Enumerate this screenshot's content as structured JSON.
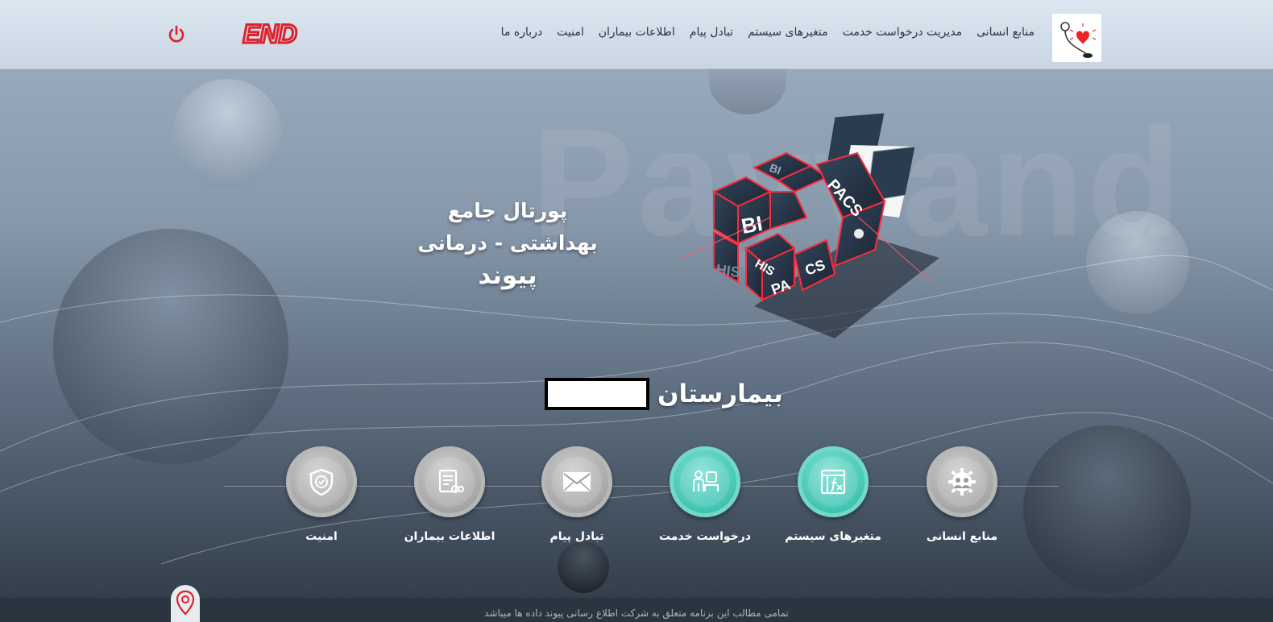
{
  "nav": {
    "items": [
      "منابع انسانی",
      "مدیریت درخواست خدمت",
      "متغیرهای سیستم",
      "تبادل پیام",
      "اطلاعات بیماران",
      "امنیت",
      "درباره ما"
    ]
  },
  "brand": {
    "text": "END"
  },
  "watermark": "Payvand",
  "hero": {
    "line1": "پورتال جامع",
    "line2": "بهداشتی - درمانی",
    "line3": "پیوند"
  },
  "cube_labels": [
    "BI",
    "PACS",
    "BI",
    "HIS",
    "HIS",
    "PA",
    "CS"
  ],
  "hospital": {
    "label": "بیمارستان"
  },
  "tiles": [
    {
      "label": "منابع انسانی",
      "icon": "gear-people-icon",
      "accent": "gray"
    },
    {
      "label": "متغیرهای سیستم",
      "icon": "function-window-icon",
      "accent": "teal"
    },
    {
      "label": "درخواست خدمت",
      "icon": "service-request-icon",
      "accent": "teal"
    },
    {
      "label": "تبادل پیام",
      "icon": "envelope-icon",
      "accent": "gray"
    },
    {
      "label": "اطلاعات بیماران",
      "icon": "patient-record-icon",
      "accent": "gray"
    },
    {
      "label": "امنیت",
      "icon": "shield-check-icon",
      "accent": "gray"
    }
  ],
  "footer": {
    "text": "تمامی مطالب این برنامه متعلق به شرکت اطلاع رسانی پیوند داده ها میباشد"
  },
  "colors": {
    "brand_red": "#e0202a",
    "teal": "#46c6b5",
    "gray": "#a9a9a9"
  }
}
